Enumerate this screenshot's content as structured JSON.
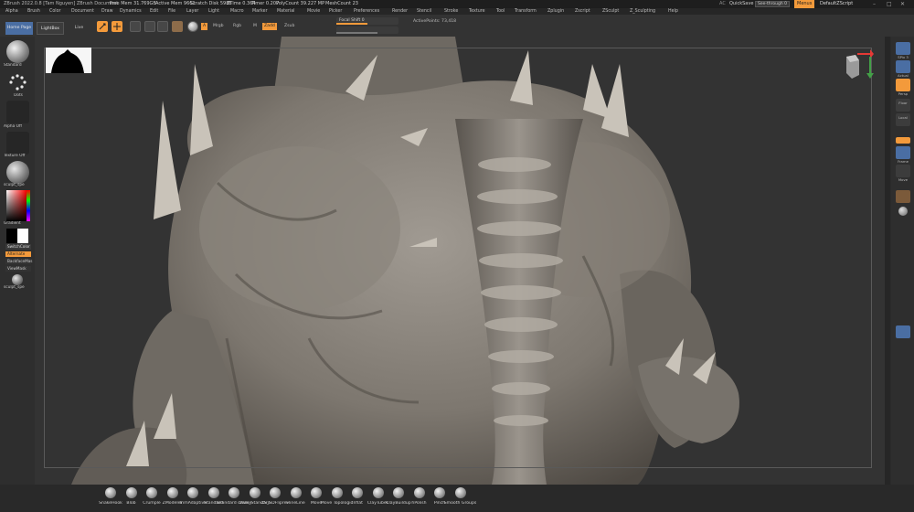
{
  "titlebar": {
    "app_info": "ZBrush 2022.0.8 [Tam Nguyen]   ZBrush Document",
    "free_mem": "Free Mem 31.769GB",
    "active_mem": "Active Mem 9661",
    "scratch_disk": "Scratch Disk 5986",
    "ztime": "ZTime 0.364",
    "timer": "Timer 0.207",
    "polycount": "PolyCount 39.227 MP",
    "meshcount": "MeshCount 23",
    "ac_label": "AC",
    "quicksave": "QuickSave",
    "see_through": "See-through 0",
    "menus": "Menus",
    "default_zscript": "DefaultZScript"
  },
  "menubar": [
    "Alpha",
    "Brush",
    "Color",
    "Document",
    "Draw",
    "Dynamics",
    "Edit",
    "File",
    "Layer",
    "Light",
    "Macro",
    "Marker",
    "Material",
    "Movie",
    "Picker",
    "Preferences",
    "Render",
    "Stencil",
    "Stroke",
    "Texture",
    "Tool",
    "Transform",
    "Zplugin",
    "Zscript",
    "ZSculpt",
    "Z_Sculpting",
    "Help"
  ],
  "topshelf": {
    "home_page": "Home Page",
    "lightbox": "LightBox",
    "live_boolean": "Live Boolean",
    "mrgb": "Mrgb",
    "rgb": "Rgb",
    "m": "M",
    "zadd": "Zadd",
    "zsub": "Zsub",
    "focal_shift": "Focal Shift 0",
    "active_points": "ActivePoints: 73,418"
  },
  "leftpanel": {
    "standard": "Standard",
    "dots": "Dots",
    "alpha_off": "Alpha Off",
    "texture_off": "Texture Off",
    "sculpt_spec": "sculpt_spe",
    "gradient": "Gradient",
    "switch_color": "SwitchColor",
    "alternate": "Alternate",
    "backface_mask": "BackfaceMas",
    "viewmask": "ViewMask",
    "sculpt_spec2": "sculpt_spe"
  },
  "rightpanel": {
    "scroll": "Scroll",
    "zoom": "Zoom",
    "actual": "Actual",
    "persp": "Persp",
    "floor": "Floor",
    "local": "Local",
    "frame": "Frame",
    "move": "Move",
    "rotate": "Rotate",
    "transp": "Transp",
    "solo": "Solo",
    "xpose": "Xpose"
  },
  "bottomtray": [
    "SnakeHook",
    "Blob",
    "Crumple",
    "ZModeler",
    "TrimAdaptive",
    "Standard",
    "tolandard crease",
    "Dam_Standard",
    "ZS_SDFliprev",
    "FlineLine",
    "Move",
    "Move Topologic",
    "Inflat",
    "ClayTubes",
    "ClayBuildup",
    "hPolish",
    "Pinch",
    "Smooth Groups"
  ],
  "colors": {
    "accent_orange": "#f39a3b",
    "accent_blue": "#4a6ea3",
    "bg_dark": "#2b2b2b",
    "canvas_bg": "#333333",
    "clay": "#8a847c"
  }
}
